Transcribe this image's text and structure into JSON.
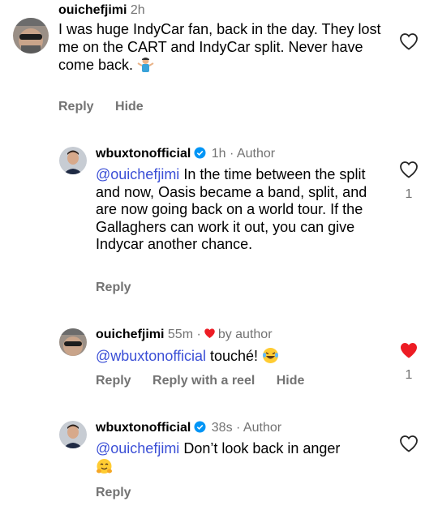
{
  "comments": [
    {
      "username": "ouichefjimi",
      "time": "2h",
      "text": "I was huge IndyCar fan, back in the day. They lost me on the CART and IndyCar split. Never have come back.",
      "emoji": "person-shrugging",
      "actions": [
        "Reply",
        "Hide"
      ]
    },
    {
      "username": "wbuxtonofficial",
      "time": "1h",
      "author_label": "Author",
      "mention": "@ouichefjimi",
      "text": " In the time between the split and now, Oasis became a band, split, and are now going back on a world tour. If the Gallaghers can work it out, you can give Indycar another chance.",
      "like_count": "1",
      "actions": [
        "Reply"
      ]
    },
    {
      "username": "ouichefjimi",
      "time": "55m",
      "liked_by": "by author",
      "mention": "@wbuxtonofficial",
      "text": " touché!",
      "emoji": "laughing-tears",
      "like_count": "1",
      "liked": true,
      "actions": [
        "Reply",
        "Reply with a reel",
        "Hide"
      ]
    },
    {
      "username": "wbuxtonofficial",
      "time": "38s",
      "author_label": "Author",
      "mention": "@ouichefjimi",
      "text": " Don’t look back in anger",
      "emoji": "hugging-face",
      "actions": [
        "Reply"
      ]
    }
  ],
  "colors": {
    "mention": "#3b4fd6",
    "meta": "#737373",
    "liked_heart": "#ed1c24",
    "verified": "#0095f6"
  }
}
